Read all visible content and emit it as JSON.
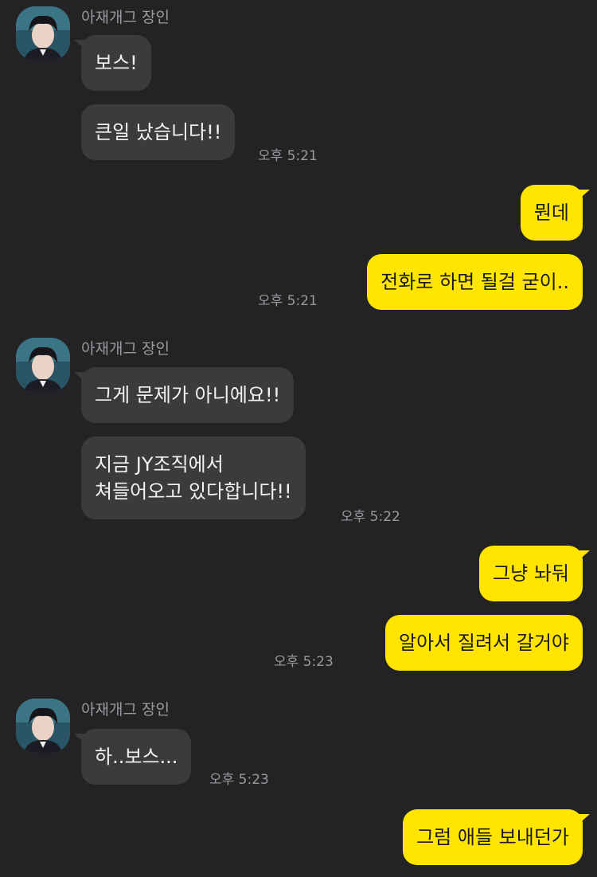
{
  "chat": {
    "sender_name": "아재개그 장인",
    "groups": [
      {
        "messages": [
          "보스!",
          "큰일 났습니다!!"
        ],
        "time": "오후 5:21"
      },
      {
        "messages": [
          "뭔데",
          "전화로 하면 될걸 굳이.."
        ],
        "time": "오후 5:21"
      },
      {
        "messages": [
          "그게 문제가 아니에요!!",
          [
            "지금 JY조직에서",
            "쳐들어오고 있다합니다!!"
          ]
        ],
        "time": "오후 5:22"
      },
      {
        "messages": [
          "그냥 놔둬",
          "알아서 질려서 갈거야"
        ],
        "time": "오후 5:23"
      },
      {
        "messages": [
          "하..보스..."
        ],
        "time": "오후 5:23"
      },
      {
        "messages": [
          "그럼 애들 보내던가"
        ]
      }
    ]
  },
  "colors": {
    "background": "#232325",
    "incoming_bubble": "#3b3b3e",
    "outgoing_bubble": "#ffe500"
  },
  "icons": {
    "avatar": "profile-photo"
  }
}
